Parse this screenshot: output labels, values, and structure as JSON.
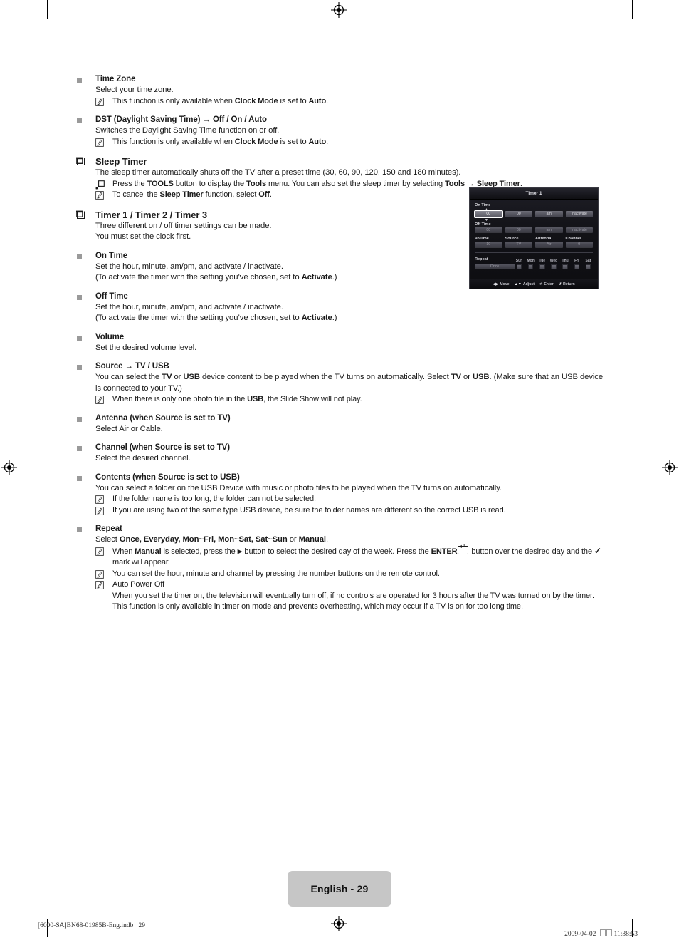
{
  "page": {
    "language_tag": "English - 29",
    "footer_left": "[6000-SA]BN68-01985B-Eng.indb   29",
    "footer_right_date": "2009-04-02",
    "footer_right_time": "11:38:53"
  },
  "sections": [
    {
      "id": "time-zone",
      "marker": "square",
      "heading": "Time Zone",
      "lines": [
        "Select your time zone."
      ],
      "notes": [
        {
          "icon": "note-icon",
          "html": "This function is only available when <b>Clock Mode</b> is set to <b>Auto</b>."
        }
      ]
    },
    {
      "id": "dst",
      "marker": "square",
      "heading": "DST (Daylight Saving Time) → Off / On / Auto",
      "lines": [
        "Switches the Daylight Saving Time function on or off."
      ],
      "notes": [
        {
          "icon": "note-icon",
          "html": "This function is only available when <b>Clock Mode</b> is set to <b>Auto</b>."
        }
      ]
    },
    {
      "id": "sleep-timer",
      "marker": "chapter",
      "heading": "Sleep Timer",
      "lines": [
        "The sleep timer automatically shuts off the TV after a preset time (30, 60, 90, 120, 150 and 180 minutes)."
      ],
      "notes": [
        {
          "icon": "tools-icon",
          "html": "Press the <b>TOOLS</b> button to display the <b>Tools</b> menu. You can also set the sleep timer by selecting <b>Tools → Sleep Timer</b>."
        },
        {
          "icon": "note-icon",
          "html": "To cancel the <b>Sleep Timer</b> function, select <b>Off</b>."
        }
      ]
    },
    {
      "id": "timer-123",
      "marker": "chapter",
      "heading": "Timer 1 / Timer 2 / Timer 3",
      "lines": [
        "Three different on / off timer settings can be made.",
        "You must set the clock first."
      ],
      "notes": []
    },
    {
      "id": "on-time",
      "marker": "square",
      "heading": "On Time",
      "lines": [
        "Set the hour, minute, am/pm, and activate / inactivate.",
        "(To activate the timer with the setting you’ve chosen, set to <b>Activate</b>.)"
      ],
      "notes": []
    },
    {
      "id": "off-time",
      "marker": "square",
      "heading": "Off Time",
      "lines": [
        "Set the hour, minute, am/pm, and activate / inactivate.",
        "(To activate the timer with the setting you’ve chosen, set to <b>Activate</b>.)"
      ],
      "notes": []
    },
    {
      "id": "volume",
      "marker": "square",
      "heading": "Volume",
      "lines": [
        "Set the desired volume level."
      ],
      "notes": []
    },
    {
      "id": "source",
      "marker": "square",
      "heading": "Source → TV / USB",
      "lines": [
        "You can select the <b>TV</b> or <b>USB</b> device content to be played when the TV turns on automatically. Select <b>TV</b> or <b>USB</b>. (Make sure that an USB device is connected to your TV.)"
      ],
      "notes": [
        {
          "icon": "note-icon",
          "html": "When there is only one photo file in the <b>USB</b>, the Slide Show will not play."
        }
      ]
    },
    {
      "id": "antenna",
      "marker": "square",
      "heading": "Antenna (when Source is set to TV)",
      "lines": [
        "Select Air or Cable."
      ],
      "notes": []
    },
    {
      "id": "channel",
      "marker": "square",
      "heading": "Channel (when Source is set to TV)",
      "lines": [
        "Select the desired channel."
      ],
      "notes": []
    },
    {
      "id": "contents",
      "marker": "square",
      "heading": "Contents (when Source is set to USB)",
      "lines": [
        "You can select a folder on the USB Device with music or photo files to be played when the TV turns on automatically."
      ],
      "notes": [
        {
          "icon": "note-icon",
          "html": "If the folder name is too long, the folder can not be selected."
        },
        {
          "icon": "note-icon",
          "html": "If you are using two of the same type USB device, be sure the folder names are different so the correct USB is read."
        }
      ]
    },
    {
      "id": "repeat",
      "marker": "square",
      "heading": "Repeat",
      "lines": [
        "Select <b>Once, Everyday, Mon~Fri, Mon~Sat, Sat~Sun</b> or <b>Manual</b>."
      ],
      "notes": [
        {
          "icon": "note-icon",
          "html": "When <b>Manual</b> is selected, press the <span class=\"tri-right\">▶</span> button to select the desired day of the week. Press the <b>ENTER</b><span class=\"enter-ico\"></span> button over the desired day and the <span class=\"check-glyph\">✓</span> mark will appear."
        },
        {
          "icon": "note-icon",
          "html": "You can set the hour, minute and channel by pressing the number buttons on the remote control."
        },
        {
          "icon": "note-icon",
          "html": "Auto Power Off<br>When you set the timer on, the television will eventually turn off, if no controls are operated for 3 hours after the TV was turned on by the timer. This function is only available in timer on mode and prevents overheating, which may occur if a TV is on for too long time."
        }
      ]
    }
  ],
  "osd": {
    "title": "Timer 1",
    "on_time_label": "On Time",
    "on_time": {
      "hour": "00",
      "minute": "00",
      "ampm": "am",
      "state": "Inactivate"
    },
    "off_time_label": "Off Time",
    "off_time": {
      "hour": "00",
      "minute": "00",
      "ampm": "am",
      "state": "Inactivate"
    },
    "quad_labels": {
      "volume": "Volume",
      "source": "Source",
      "antenna": "Antenna",
      "channel": "Channel"
    },
    "quad_values": {
      "volume": "10",
      "source": "TV",
      "antenna": "Air",
      "channel": "0"
    },
    "repeat_label": "Repeat",
    "repeat_value": "Once",
    "days": [
      "Sun",
      "Mon",
      "Tue",
      "Wed",
      "Thu",
      "Fri",
      "Sat"
    ],
    "footer": [
      {
        "icon": "left-right-arrows-icon",
        "label": "Move"
      },
      {
        "icon": "up-down-arrows-icon",
        "label": "Adjust"
      },
      {
        "icon": "enter-key-icon",
        "label": "Enter"
      },
      {
        "icon": "return-arrow-icon",
        "label": "Return"
      }
    ]
  }
}
